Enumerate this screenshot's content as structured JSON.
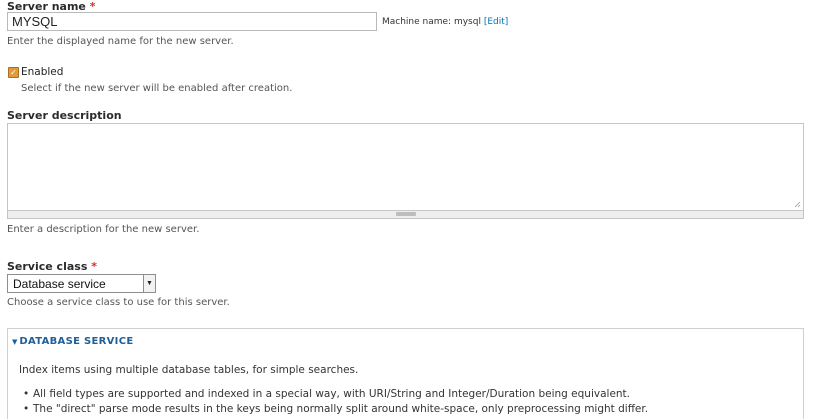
{
  "server_name": {
    "label": "Server name",
    "required_mark": "*",
    "value": "MYSQL",
    "machine_name_prefix": "Machine name: mysql",
    "machine_name_edit": "[Edit]",
    "description": "Enter the displayed name for the new server."
  },
  "enabled": {
    "label": "Enabled",
    "checked": true,
    "description": "Select if the new server will be enabled after creation."
  },
  "server_description": {
    "label": "Server description",
    "value": "",
    "description": "Enter a description for the new server."
  },
  "service_class": {
    "label": "Service class",
    "required_mark": "*",
    "selected": "Database service",
    "description": "Choose a service class to use for this server."
  },
  "database_service": {
    "legend": "DATABASE SERVICE",
    "intro": "Index items using multiple database tables, for simple searches.",
    "bullets": [
      "All field types are supported and indexed in a special way, with URI/String and Integer/Duration being equivalent.",
      "The \"direct\" parse mode results in the keys being normally split around white-space, only preprocessing might differ."
    ]
  },
  "colors": {
    "required": "#d62d2d",
    "link": "#0074bd",
    "legend": "#1f5f99",
    "checkbox": "#e09a3a"
  }
}
